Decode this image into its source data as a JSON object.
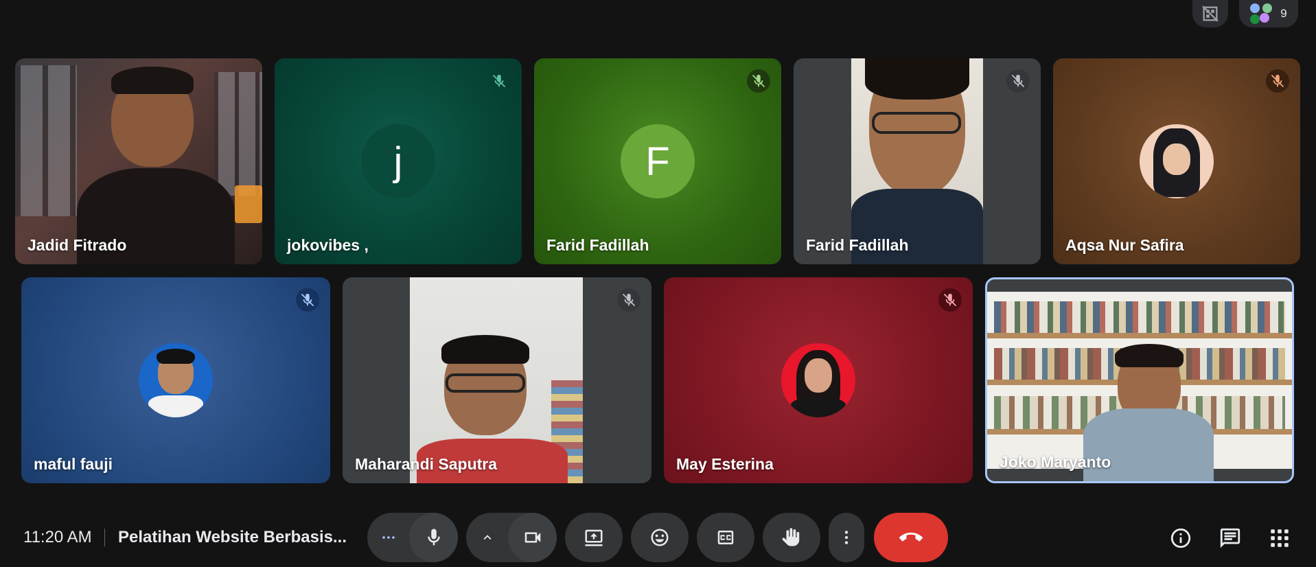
{
  "top": {
    "participant_count": "9"
  },
  "tiles": [
    {
      "name": "Jadid Fitrado"
    },
    {
      "name": "jokovibes ,",
      "initial": "j"
    },
    {
      "name": "Farid Fadillah",
      "initial": "F"
    },
    {
      "name": "Farid Fadillah"
    },
    {
      "name": "Aqsa Nur Safira"
    },
    {
      "name": "maful fauji"
    },
    {
      "name": "Maharandi Saputra"
    },
    {
      "name": "May Esterina"
    },
    {
      "name": "Joko Maryanto"
    }
  ],
  "bottom": {
    "time": "11:20 AM",
    "meeting_title": "Pelatihan Website Berbasis..."
  },
  "colors": {
    "end_call": "#dc362e",
    "accent_border": "#a8c7fa"
  },
  "icons": [
    "more-options-icon",
    "microphone-icon",
    "chevron-up-icon",
    "camera-icon",
    "present-screen-icon",
    "emoji-icon",
    "captions-icon",
    "raise-hand-icon",
    "more-vert-icon",
    "end-call-icon",
    "info-icon",
    "chat-icon",
    "apps-grid-icon",
    "mic-off-icon",
    "layout-off-icon"
  ]
}
